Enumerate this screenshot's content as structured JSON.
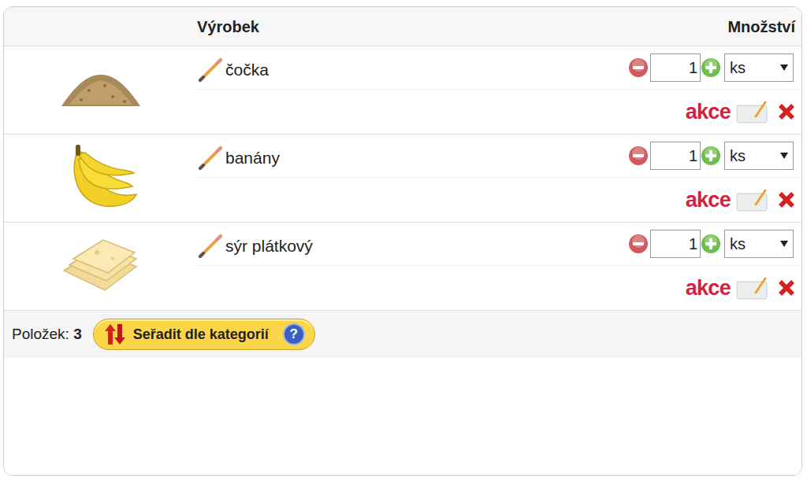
{
  "table": {
    "columns": [
      "Výrobek",
      "Množství"
    ]
  },
  "items": [
    {
      "name": "čočka",
      "kind": "lentils",
      "quantity": "1",
      "unit": "ks",
      "badge": "akce"
    },
    {
      "name": "banány",
      "kind": "bananas",
      "quantity": "1",
      "unit": "ks",
      "badge": "akce"
    },
    {
      "name": "sýr plátkový",
      "kind": "cheese",
      "quantity": "1",
      "unit": "ks",
      "badge": "akce"
    }
  ],
  "footer": {
    "count_label": "Položek:",
    "count": "3",
    "sort_button": "Seřadit dle kategorií",
    "help": "?"
  }
}
